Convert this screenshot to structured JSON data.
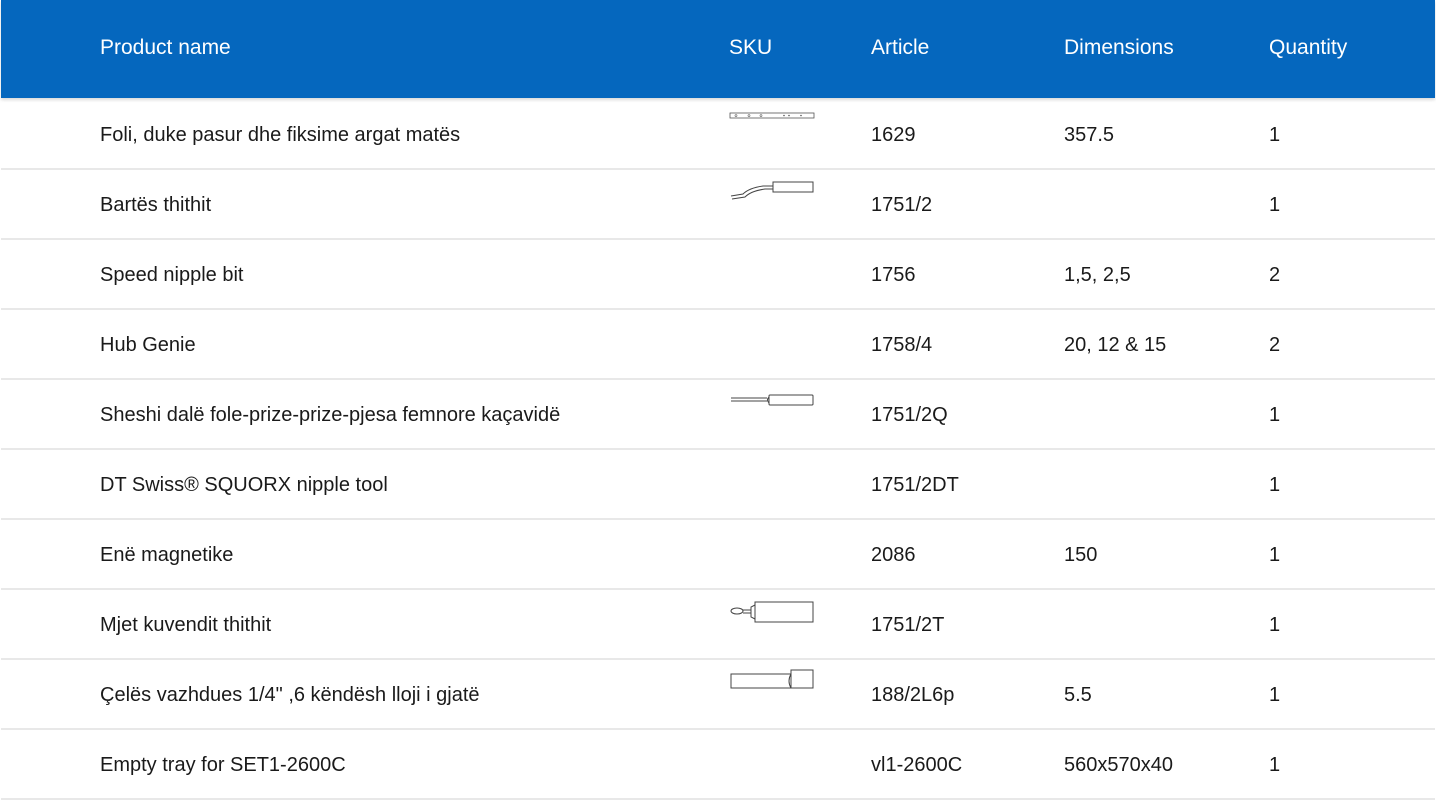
{
  "header": {
    "product_name": "Product name",
    "sku": "SKU",
    "article": "Article",
    "dimensions": "Dimensions",
    "quantity": "Quantity"
  },
  "colors": {
    "header_bg": "#0567be",
    "header_text": "#ffffff",
    "row_divider": "#e8e8e8"
  },
  "rows": [
    {
      "name": "Foli, duke pasur dhe fiksime argat matës",
      "sku_icon": "ruler-icon",
      "article": "1629",
      "dimensions": "357.5",
      "quantity": "1"
    },
    {
      "name": "Bartës thithit",
      "sku_icon": "bent-nipple-holder-icon",
      "article": "1751/2",
      "dimensions": "",
      "quantity": "1"
    },
    {
      "name": "Speed nipple bit",
      "sku_icon": "",
      "article": "1756",
      "dimensions": "1,5, 2,5",
      "quantity": "2"
    },
    {
      "name": "Hub Genie",
      "sku_icon": "",
      "article": "1758/4",
      "dimensions": "20, 12 & 15",
      "quantity": "2"
    },
    {
      "name": "Sheshi dalë fole-prize-prize-pjesa femnore kaçavidë",
      "sku_icon": "screwdriver-icon",
      "article": "1751/2Q",
      "dimensions": "",
      "quantity": "1"
    },
    {
      "name": "DT Swiss® SQUORX nipple tool",
      "sku_icon": "",
      "article": "1751/2DT",
      "dimensions": "",
      "quantity": "1"
    },
    {
      "name": "Enë magnetike",
      "sku_icon": "",
      "article": "2086",
      "dimensions": "150",
      "quantity": "1"
    },
    {
      "name": "Mjet kuvendit thithit",
      "sku_icon": "nipple-assembly-tool-icon",
      "article": "1751/2T",
      "dimensions": "",
      "quantity": "1"
    },
    {
      "name": "Çelës vazhdues 1/4\" ,6 këndësh lloji i gjatë",
      "sku_icon": "socket-extension-icon",
      "article": "188/2L6p",
      "dimensions": "5.5",
      "quantity": "1"
    },
    {
      "name": "Empty tray for SET1-2600C",
      "sku_icon": "",
      "article": "vl1-2600C",
      "dimensions": "560x570x40",
      "quantity": "1"
    }
  ]
}
